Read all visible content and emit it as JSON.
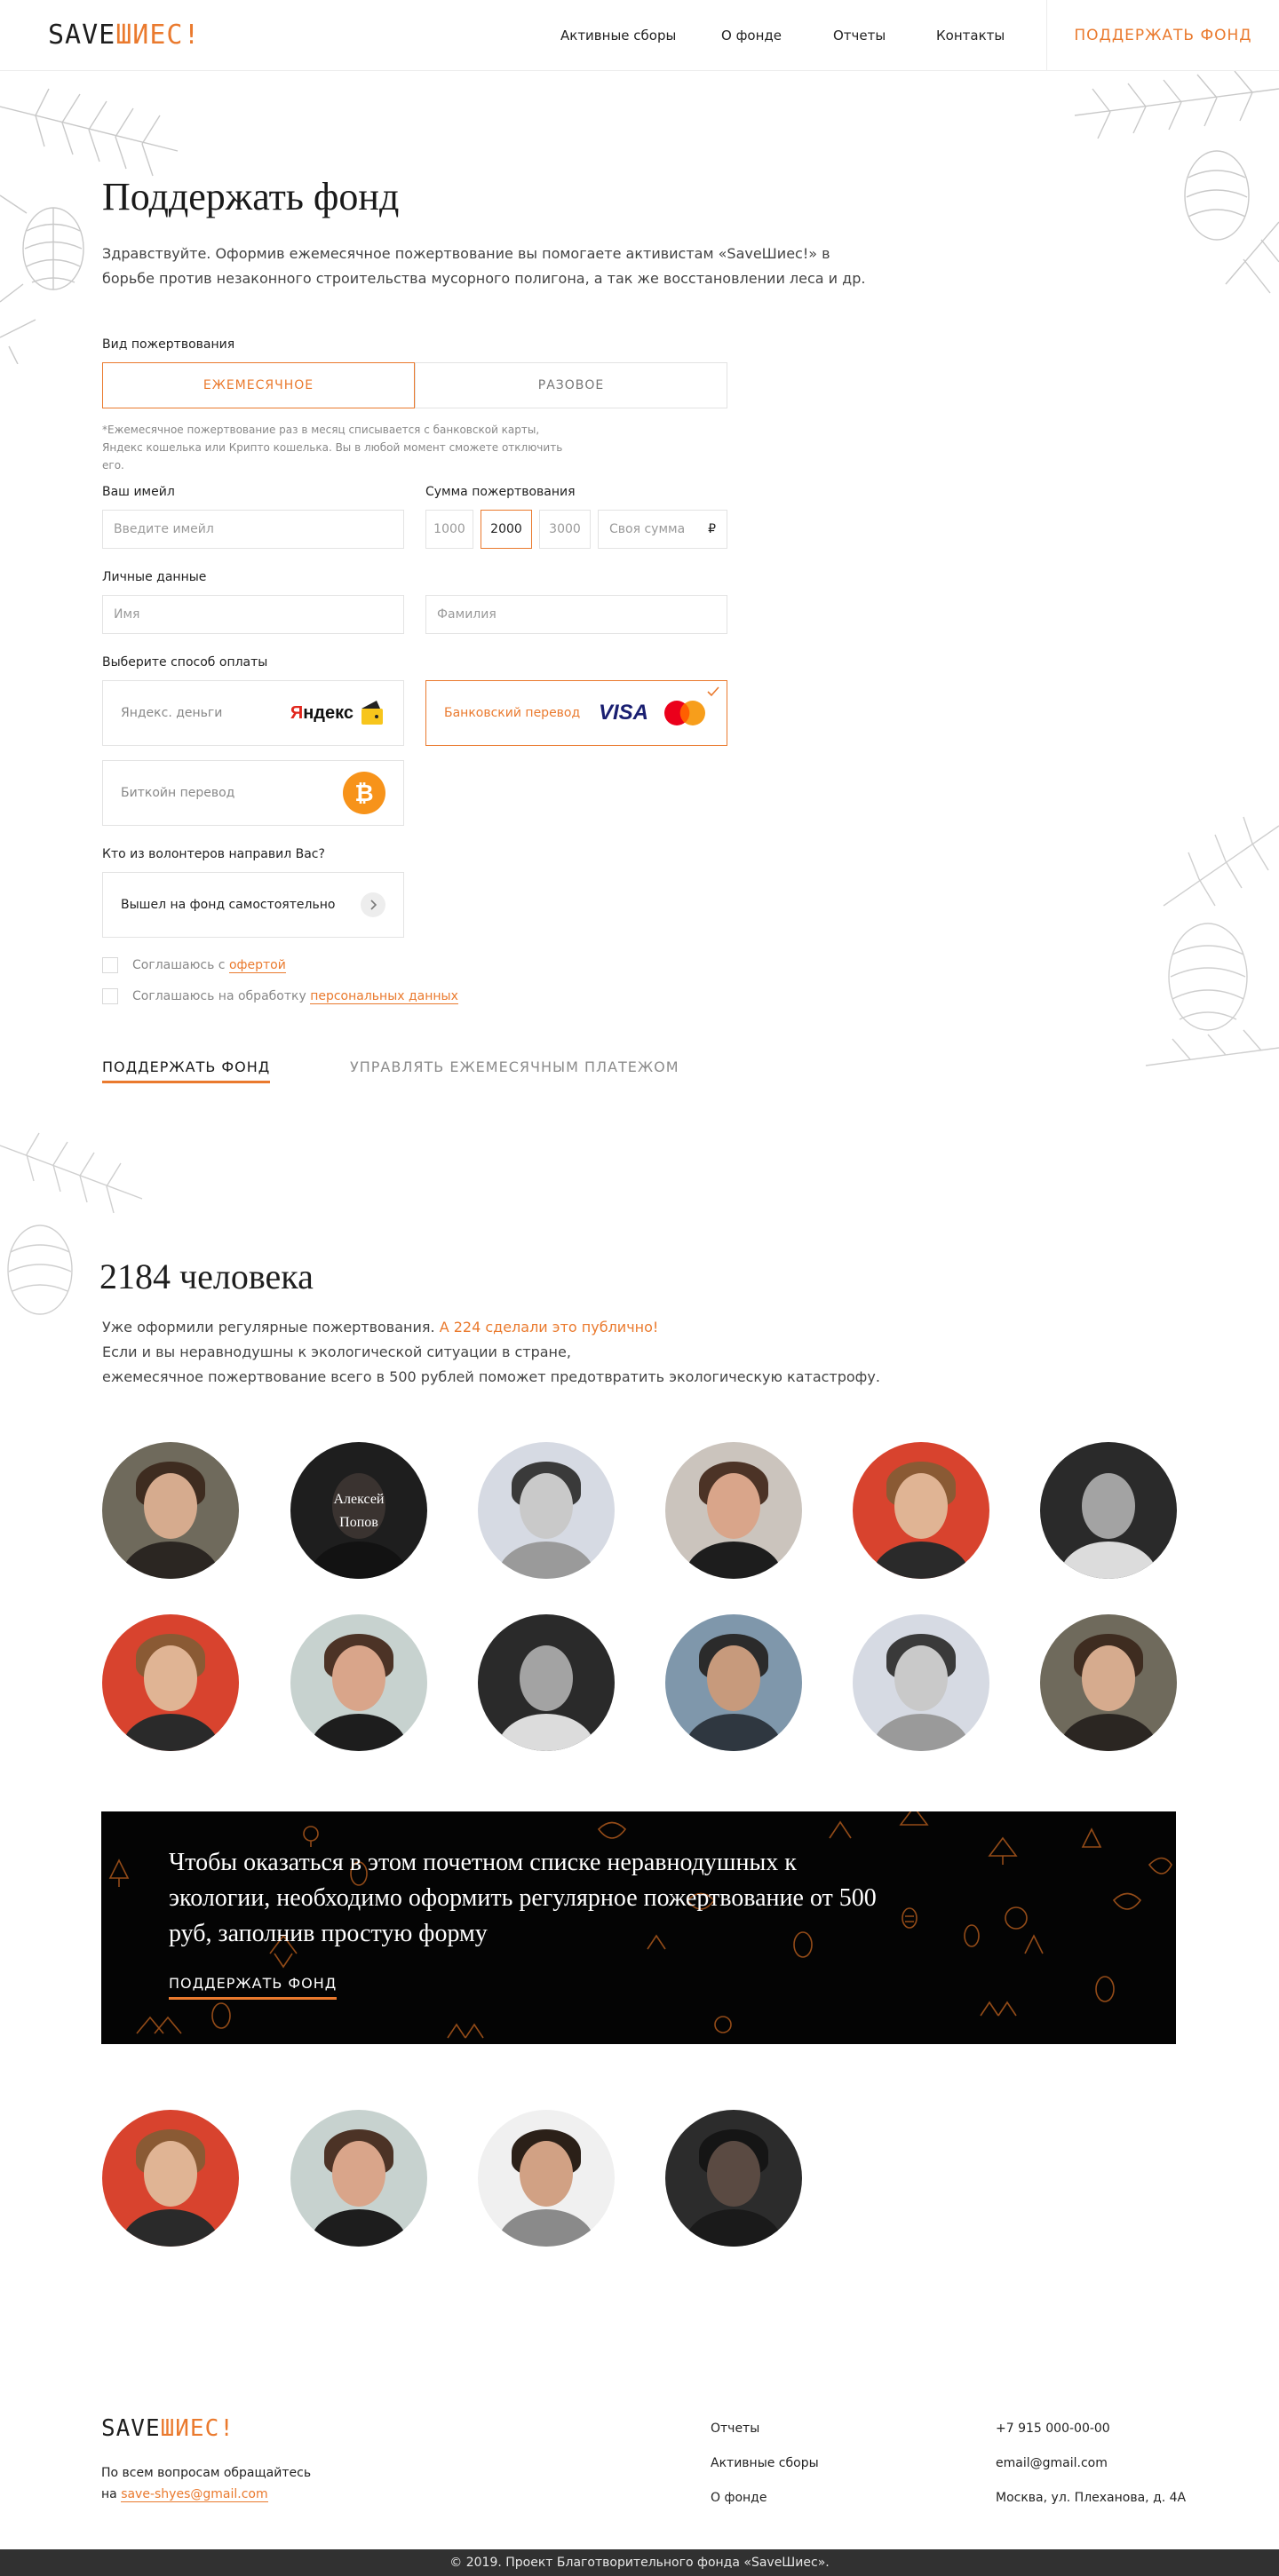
{
  "header": {
    "logo_part1": "SAVE",
    "logo_part2": "ШИЕС!",
    "nav": [
      "Активные сборы",
      "О фонде",
      "Отчеты",
      "Контакты"
    ],
    "cta": "ПОДДЕРЖАТЬ ФОНД"
  },
  "form": {
    "title": "Поддержать фонд",
    "lead": "Здравствуйте. Оформив ежемесячное пожертвование вы помогаете активистам «SaveШиес!» в борьбе против незаконного строительства мусорного полигона, а так же восстановлении леса и др.",
    "donation_type_label": "Вид пожертвования",
    "donation_types": [
      "ЕЖЕМЕСЯЧНОЕ",
      "РАЗОВОЕ"
    ],
    "note": "*Ежемесячное пожертвование раз в месяц списывается с банковской карты, Яндекс кошелька или Крипто кошелька. Вы в любой момент сможете отключить его.",
    "email_label": "Ваш имейл",
    "email_placeholder": "Введите имейл",
    "amount_label": "Сумма пожертвования",
    "amounts": [
      "1000",
      "2000",
      "3000"
    ],
    "custom_amount_placeholder": "Своя сумма",
    "currency": "₽",
    "personal_label": "Личные данные",
    "first_name_placeholder": "Имя",
    "last_name_placeholder": "Фамилия",
    "payment_label": "Выберите способ оплаты",
    "payment_methods": [
      "Яндекс. деньги",
      "Банковский перевод",
      "Биткойн перевод"
    ],
    "yandex_logo": "Яндекс",
    "visa_logo": "VISA",
    "volunteer_label": "Кто из волонтеров направил Вас?",
    "volunteer_value": "Вышел на фонд самостоятельно",
    "agree1_text": "Соглашаюсь с ",
    "agree1_link": "офертой",
    "agree2_text": "Соглашаюсь на обработку ",
    "agree2_link": "персональных данных",
    "submit": "ПОДДЕРЖАТЬ ФОНД",
    "manage": "УПРАВЛЯТЬ ЕЖЕМЕСЯЧНЫМ ПЛАТЕЖОМ"
  },
  "supporters": {
    "count_title": "2184 человека",
    "line1": "Уже оформили регулярные пожертвования. ",
    "line1_highlight": "А 224 сделали это публично!",
    "line2": "Если и вы неравнодушны к экологической ситуации в стране,",
    "line3": "ежемесячное пожертвование всего в 500 рублей поможет предотвратить экологическую катастрофу.",
    "named_first": "Алексей",
    "named_last": "Попов"
  },
  "banner": {
    "text": "Чтобы оказаться в этом почетном списке неравнодушных к экологии, необходимо оформить регулярное пожертвование от 500 руб, заполнив простую форму",
    "button": "ПОДДЕРЖАТЬ ФОНД"
  },
  "footer": {
    "logo_part1": "SAVE",
    "logo_part2": "ШИЕС!",
    "contact_text": "По всем вопросам обращайтесь",
    "contact_prefix": "на ",
    "contact_email": "save-shyes@gmail.com",
    "links": [
      "Отчеты",
      "Активные сборы",
      "О фонде"
    ],
    "phone": "+7 915 000-00-00",
    "email": "email@gmail.com",
    "address": "Москва, ул. Плеханова, д. 4А",
    "copyright": "© 2019. Проект Благотворительного фонда «SaveШиес»."
  },
  "colors": {
    "accent": "#ea7a2e",
    "banner_bg": "#040404",
    "footer_bar": "#313131"
  }
}
